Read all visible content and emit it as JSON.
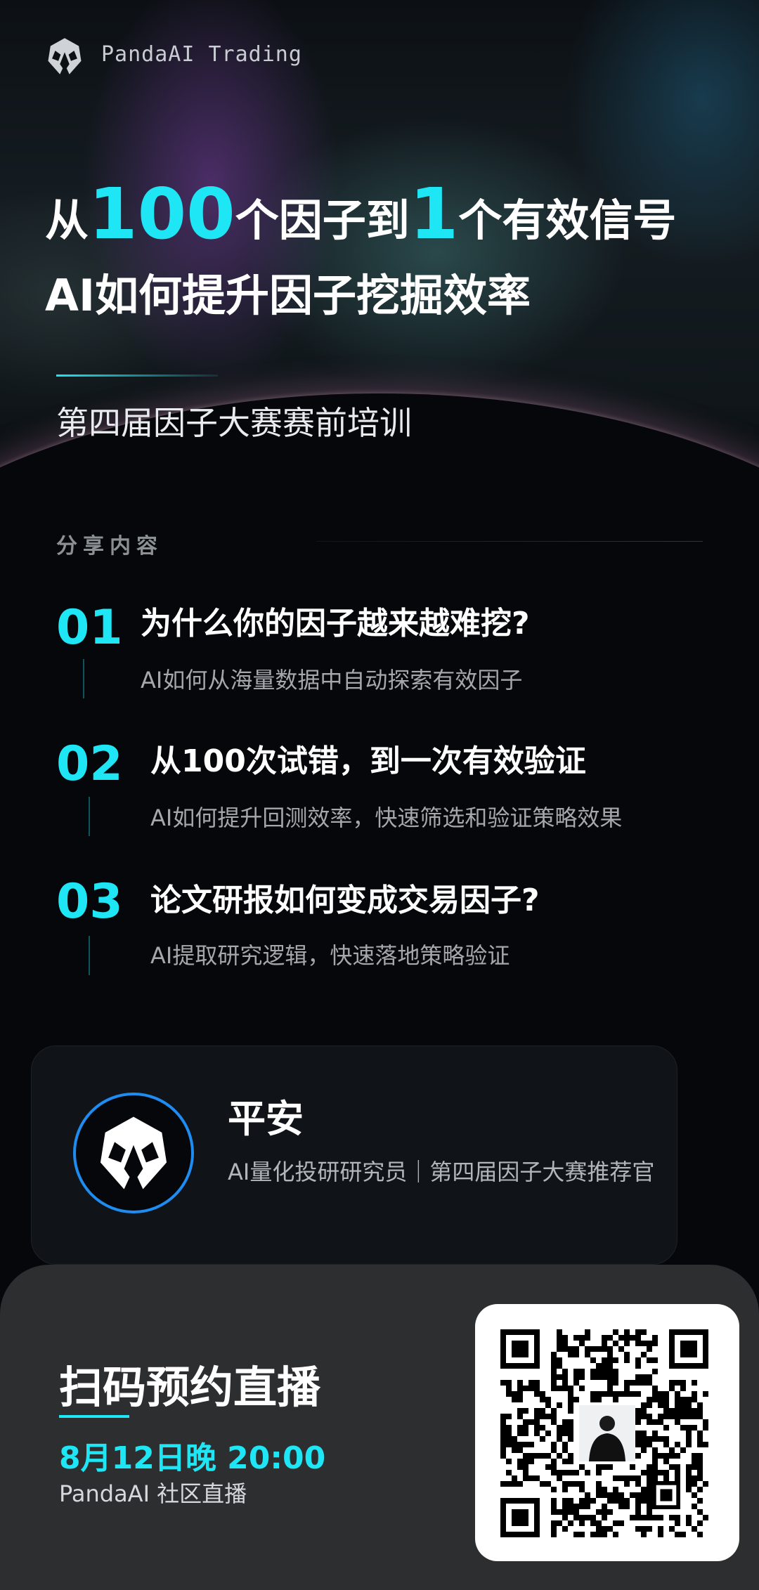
{
  "brand": {
    "name": "PandaAI Trading",
    "logo_icon": "panda-logo-icon"
  },
  "headline": {
    "line1_part1": "从",
    "line1_num1": "100",
    "line1_part2": "个因子到",
    "line1_num2": "1",
    "line1_part3": "个有效信号",
    "line2": "AI如何提升因子挖掘效率"
  },
  "subtitle": "第四届因子大赛赛前培训",
  "section_label": "分享内容",
  "items": [
    {
      "num": "01",
      "title": "为什么你的因子越来越难挖?",
      "desc": "AI如何从海量数据中自动探索有效因子"
    },
    {
      "num": "02",
      "title": "从100次试错，到一次有效验证",
      "desc": "AI如何提升回测效率，快速筛选和验证策略效果"
    },
    {
      "num": "03",
      "title": "论文研报如何变成交易因子?",
      "desc": "AI提取研究逻辑，快速落地策略验证"
    }
  ],
  "speaker": {
    "name": "平安",
    "role": "AI量化投研研究员｜第四届因子大赛推荐官",
    "avatar_icon": "panda-logo-icon"
  },
  "cta": {
    "title": "扫码预约直播",
    "time": "8月12日晚 20:00",
    "platform": "PandaAI 社区直播",
    "qr_icon": "qr-code-icon"
  },
  "colors": {
    "accent": "#1ee6f4",
    "background": "#05070a",
    "card": "#101318",
    "panel": "#2d2e30",
    "avatar_ring": "#1e8cf0"
  }
}
